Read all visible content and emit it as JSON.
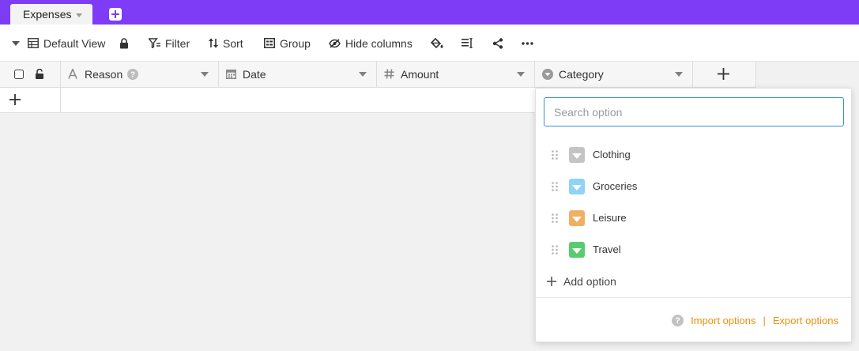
{
  "tabs": {
    "active_label": "Expenses"
  },
  "toolbar": {
    "view_label": "Default View",
    "filter_label": "Filter",
    "sort_label": "Sort",
    "group_label": "Group",
    "hide_columns_label": "Hide columns"
  },
  "columns": [
    {
      "name": "Reason",
      "icon": "text-icon"
    },
    {
      "name": "Date",
      "icon": "calendar-icon"
    },
    {
      "name": "Amount",
      "icon": "hash-icon"
    },
    {
      "name": "Category",
      "icon": "single-select-icon"
    }
  ],
  "category_popup": {
    "search_placeholder": "Search option",
    "options": [
      {
        "label": "Clothing",
        "color": "#c4c4c4"
      },
      {
        "label": "Groceries",
        "color": "#8fd3f5"
      },
      {
        "label": "Leisure",
        "color": "#efb064"
      },
      {
        "label": "Travel",
        "color": "#58cc6e"
      }
    ],
    "add_option_label": "Add option",
    "import_label": "Import options",
    "separator": "|",
    "export_label": "Export options"
  },
  "colors": {
    "brand": "#7e3cf7",
    "accent_link": "#e8900f",
    "focus_border": "#3a8fd8"
  }
}
